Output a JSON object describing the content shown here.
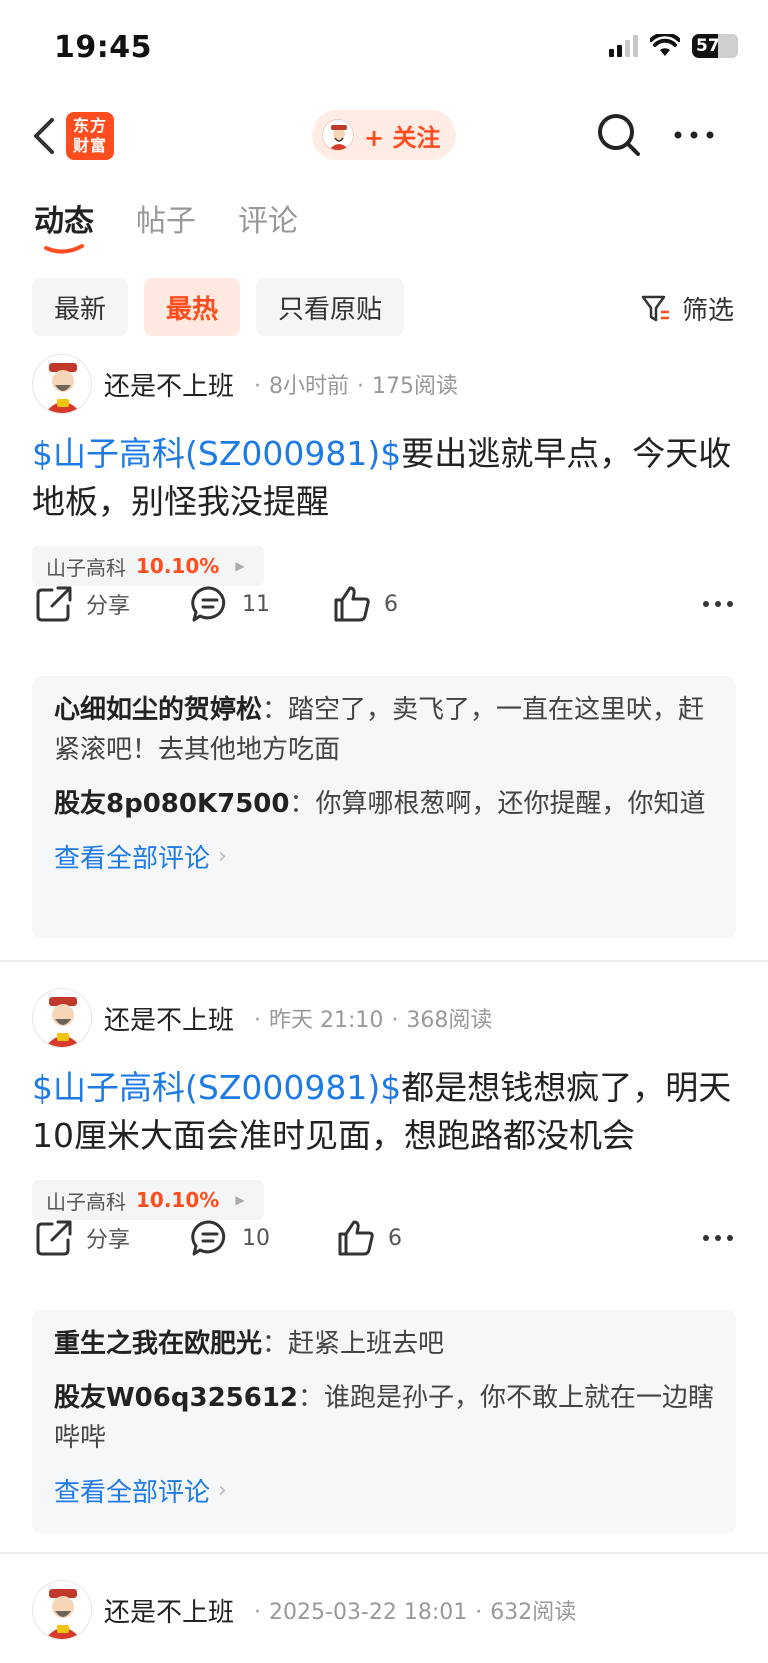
{
  "status_bar": {
    "time": "19:45",
    "battery": "57"
  },
  "nav": {
    "logo_line1": "东方",
    "logo_line2": "财富",
    "follow_label": "+ 关注"
  },
  "tabs": [
    {
      "label": "动态",
      "active": true
    },
    {
      "label": "帖子",
      "active": false
    },
    {
      "label": "评论",
      "active": false
    }
  ],
  "filters": {
    "chips": [
      {
        "label": "最新",
        "active": false
      },
      {
        "label": "最热",
        "active": true
      },
      {
        "label": "只看原贴",
        "active": false
      }
    ],
    "filter_label": "筛选"
  },
  "posts": [
    {
      "username": "还是不上班",
      "time": "8小时前",
      "reads": "175阅读",
      "stock_link": "$山子高科(SZ000981)$",
      "text": "要出逃就早点，今天收地板，别怪我没提醒",
      "tag_name": "山子高科",
      "tag_pct": "10.10%",
      "share_label": "分享",
      "comment_count": "11",
      "like_count": "6",
      "comments": [
        {
          "user": "心细如尘的贺婷松",
          "text": "：踏空了，卖飞了，一直在这里吠，赶紧滚吧！去其他地方吃面"
        },
        {
          "user": "股友8p080K7500",
          "text": "：你算哪根葱啊，还你提醒，你知道"
        }
      ],
      "view_all": "查看全部评论"
    },
    {
      "username": "还是不上班",
      "time": "昨天 21:10",
      "reads": "368阅读",
      "stock_link": "$山子高科(SZ000981)$",
      "text": "都是想钱想疯了，明天10厘米大面会准时见面，想跑路都没机会",
      "tag_name": "山子高科",
      "tag_pct": "10.10%",
      "share_label": "分享",
      "comment_count": "10",
      "like_count": "6",
      "comments": [
        {
          "user": "重生之我在欧肥光",
          "text": "：赶紧上班去吧"
        },
        {
          "user": "股友W06q325612",
          "text": "：谁跑是孙子，你不敢上就在一边瞎哔哔"
        }
      ],
      "view_all": "查看全部评论"
    },
    {
      "username": "还是不上班",
      "time": "2025-03-22 18:01",
      "reads": "632阅读"
    }
  ],
  "colors": {
    "accent": "#ff4d1f",
    "link": "#1e7be6",
    "muted": "#999999"
  }
}
